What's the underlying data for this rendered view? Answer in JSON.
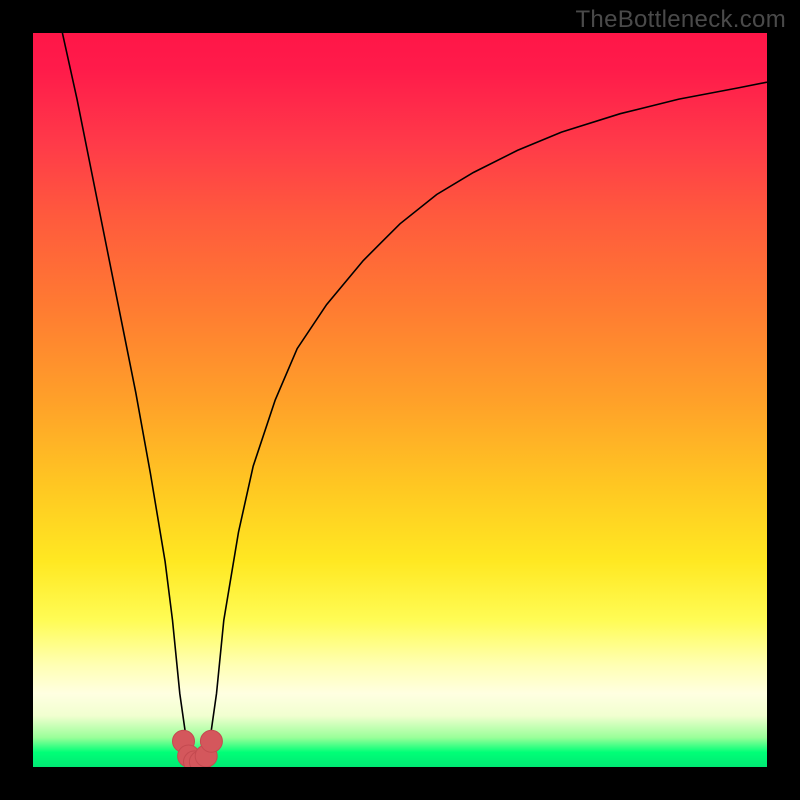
{
  "watermark": "TheBottleneck.com",
  "chart_data": {
    "type": "line",
    "title": "",
    "xlabel": "",
    "ylabel": "",
    "xlim": [
      0,
      100
    ],
    "ylim": [
      0,
      100
    ],
    "series": [
      {
        "name": "curve",
        "x": [
          4,
          6,
          8,
          10,
          12,
          14,
          16,
          18,
          19,
          20,
          21,
          22,
          23,
          24,
          25,
          26,
          28,
          30,
          33,
          36,
          40,
          45,
          50,
          55,
          60,
          66,
          72,
          80,
          88,
          96,
          100
        ],
        "values": [
          100,
          91,
          81,
          71,
          61,
          51,
          40,
          28,
          20,
          10,
          3,
          1,
          1,
          3,
          10,
          20,
          32,
          41,
          50,
          57,
          63,
          69,
          74,
          78,
          81,
          84,
          86.5,
          89,
          91,
          92.5,
          93.3
        ]
      }
    ],
    "markers": {
      "name": "bottom-cluster",
      "x": [
        20.5,
        21.2,
        22.0,
        22.8,
        23.6,
        24.3
      ],
      "values": [
        3.5,
        1.5,
        0.7,
        0.7,
        1.5,
        3.5
      ]
    }
  }
}
